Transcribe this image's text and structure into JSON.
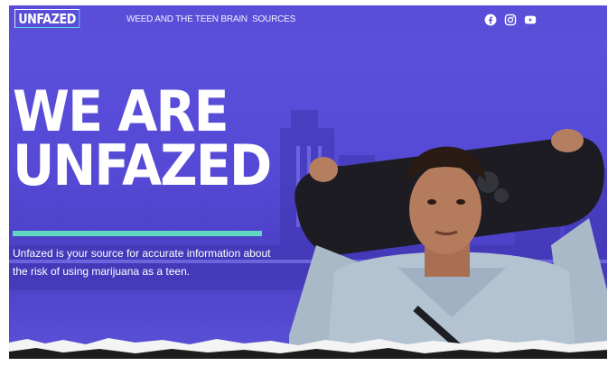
{
  "nav": {
    "logo": "UNFAZED",
    "links": [
      "WEED AND THE TEEN BRAIN",
      "SOURCES"
    ],
    "social_icons": [
      "facebook-icon",
      "instagram-icon",
      "youtube-icon"
    ]
  },
  "hero": {
    "title_line1": "WE ARE",
    "title_line2": "UNFAZED",
    "description": "Unfazed is your source for accurate information about the risk of using marijuana as a teen.",
    "image": "teen-holding-skateboard-photo"
  },
  "colors": {
    "brand_purple": "#5b4fd6",
    "accent_teal": "#5fd6c2",
    "logo_outline": "#56d7ff"
  }
}
